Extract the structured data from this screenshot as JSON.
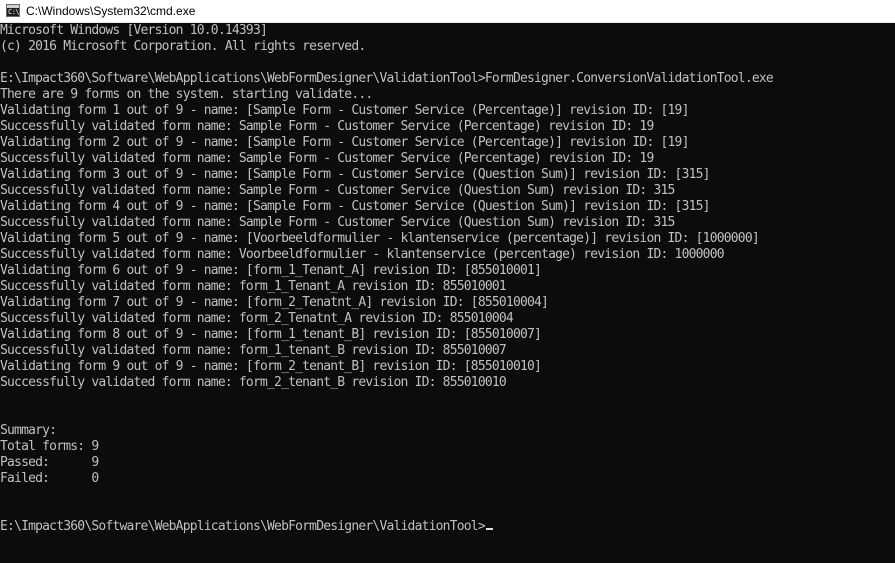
{
  "window": {
    "title": "C:\\Windows\\System32\\cmd.exe",
    "icon": "cmd-icon",
    "icon_glyph": "C:\\"
  },
  "console": {
    "background": "#0c0c0c",
    "foreground": "#c0c0c0",
    "lines": [
      "Microsoft Windows [Version 10.0.14393]",
      "(c) 2016 Microsoft Corporation. All rights reserved.",
      "",
      "E:\\Impact360\\Software\\WebApplications\\WebFormDesigner\\ValidationTool>FormDesigner.ConversionValidationTool.exe",
      "There are 9 forms on the system. starting validate...",
      "Validating form 1 out of 9 - name: [Sample Form - Customer Service (Percentage)] revision ID: [19]",
      "Successfully validated form name: Sample Form - Customer Service (Percentage) revision ID: 19",
      "Validating form 2 out of 9 - name: [Sample Form - Customer Service (Percentage)] revision ID: [19]",
      "Successfully validated form name: Sample Form - Customer Service (Percentage) revision ID: 19",
      "Validating form 3 out of 9 - name: [Sample Form - Customer Service (Question Sum)] revision ID: [315]",
      "Successfully validated form name: Sample Form - Customer Service (Question Sum) revision ID: 315",
      "Validating form 4 out of 9 - name: [Sample Form - Customer Service (Question Sum)] revision ID: [315]",
      "Successfully validated form name: Sample Form - Customer Service (Question Sum) revision ID: 315",
      "Validating form 5 out of 9 - name: [Voorbeeldformulier - klantenservice (percentage)] revision ID: [1000000]",
      "Successfully validated form name: Voorbeeldformulier - klantenservice (percentage) revision ID: 1000000",
      "Validating form 6 out of 9 - name: [form_1_Tenant_A] revision ID: [855010001]",
      "Successfully validated form name: form_1_Tenant_A revision ID: 855010001",
      "Validating form 7 out of 9 - name: [form_2_Tenatnt_A] revision ID: [855010004]",
      "Successfully validated form name: form_2_Tenatnt_A revision ID: 855010004",
      "Validating form 8 out of 9 - name: [form_1_tenant_B] revision ID: [855010007]",
      "Successfully validated form name: form_1_tenant_B revision ID: 855010007",
      "Validating form 9 out of 9 - name: [form_2_tenant_B] revision ID: [855010010]",
      "Successfully validated form name: form_2_tenant_B revision ID: 855010010",
      "",
      "",
      "Summary:",
      "Total forms: 9",
      "Passed:      9",
      "Failed:      0",
      "",
      "",
      "E:\\Impact360\\Software\\WebApplications\\WebFormDesigner\\ValidationTool>"
    ]
  }
}
